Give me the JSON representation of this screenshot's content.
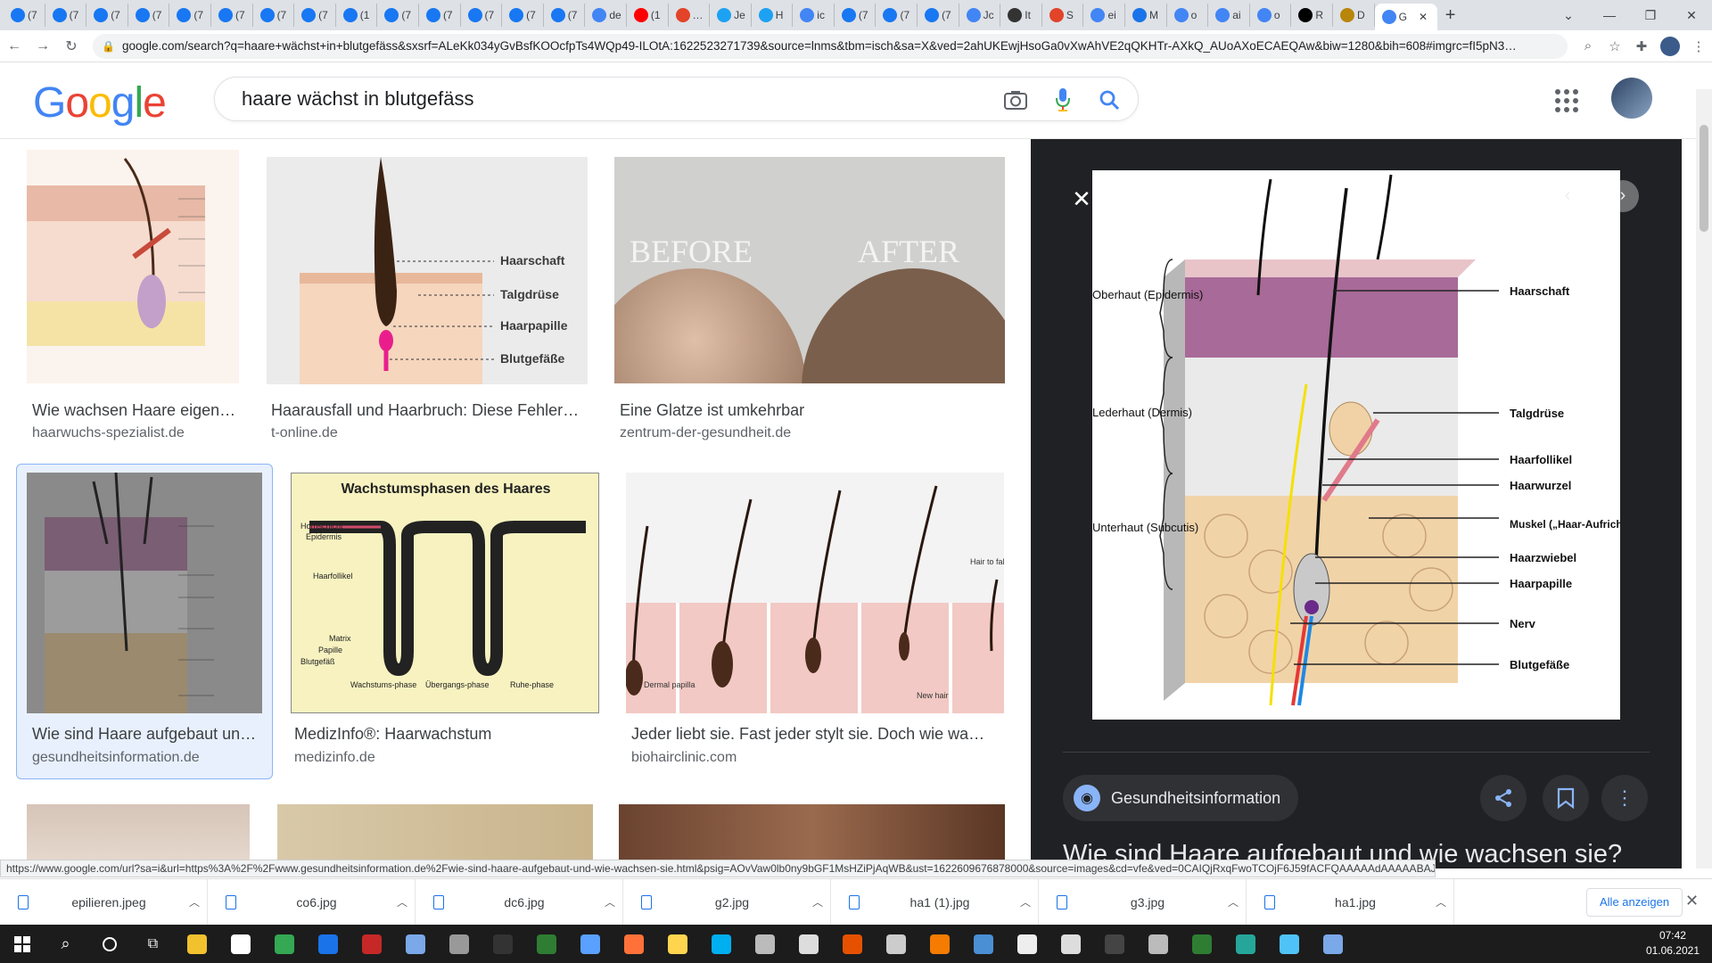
{
  "browser": {
    "tabs": [
      {
        "icon": "facebook-icon",
        "color": "#1877f2",
        "label": "(7"
      },
      {
        "icon": "facebook-icon",
        "color": "#1877f2",
        "label": "(7"
      },
      {
        "icon": "facebook-icon",
        "color": "#1877f2",
        "label": "(7"
      },
      {
        "icon": "facebook-icon",
        "color": "#1877f2",
        "label": "(7"
      },
      {
        "icon": "facebook-icon",
        "color": "#1877f2",
        "label": "(7"
      },
      {
        "icon": "facebook-icon",
        "color": "#1877f2",
        "label": "(7"
      },
      {
        "icon": "facebook-icon",
        "color": "#1877f2",
        "label": "(7"
      },
      {
        "icon": "facebook-icon",
        "color": "#1877f2",
        "label": "(7"
      },
      {
        "icon": "facebook-icon",
        "color": "#1877f2",
        "label": "(1"
      },
      {
        "icon": "facebook-icon",
        "color": "#1877f2",
        "label": "(7"
      },
      {
        "icon": "facebook-icon",
        "color": "#1877f2",
        "label": "(7"
      },
      {
        "icon": "facebook-icon",
        "color": "#1877f2",
        "label": "(7"
      },
      {
        "icon": "facebook-icon",
        "color": "#1877f2",
        "label": "(7"
      },
      {
        "icon": "facebook-icon",
        "color": "#1877f2",
        "label": "(7"
      },
      {
        "icon": "google-icon",
        "color": "#4285f4",
        "label": "de"
      },
      {
        "icon": "youtube-icon",
        "color": "#ff0000",
        "label": "(1"
      },
      {
        "icon": "gitlab-icon",
        "color": "#e24329",
        "label": "…"
      },
      {
        "icon": "twitter-icon",
        "color": "#1da1f2",
        "label": "Je"
      },
      {
        "icon": "twitter-icon",
        "color": "#1da1f2",
        "label": "H"
      },
      {
        "icon": "google-icon",
        "color": "#4285f4",
        "label": "ic"
      },
      {
        "icon": "facebook-icon",
        "color": "#1877f2",
        "label": "(7"
      },
      {
        "icon": "facebook-icon",
        "color": "#1877f2",
        "label": "(7"
      },
      {
        "icon": "facebook-icon",
        "color": "#1877f2",
        "label": "(7"
      },
      {
        "icon": "google-icon",
        "color": "#4285f4",
        "label": "Jc"
      },
      {
        "icon": "github-icon",
        "color": "#333333",
        "label": "It"
      },
      {
        "icon": "gitlab-icon",
        "color": "#e24329",
        "label": "S"
      },
      {
        "icon": "google-icon",
        "color": "#4285f4",
        "label": "ei"
      },
      {
        "icon": "m-icon",
        "color": "#1a73e8",
        "label": "M"
      },
      {
        "icon": "google-icon",
        "color": "#4285f4",
        "label": "o"
      },
      {
        "icon": "google-icon",
        "color": "#4285f4",
        "label": "ai"
      },
      {
        "icon": "google-icon",
        "color": "#4285f4",
        "label": "o"
      },
      {
        "icon": "wikipedia-icon",
        "color": "#000000",
        "label": "R"
      },
      {
        "icon": "book-icon",
        "color": "#b8860b",
        "label": "D"
      },
      {
        "icon": "google-icon",
        "color": "#4285f4",
        "label": "G",
        "active": true
      }
    ],
    "new_tab": "+",
    "url": "google.com/search?q=haare+wächst+in+blutgefäss&sxsrf=ALeKk034yGvBsfKOOcfpTs4WQp49-ILOtA:1622523271739&source=lnms&tbm=isch&sa=X&ved=2ahUKEwjHsoGa0vXwAhVE2qQKHTr-AXkQ_AUoAXoECAEQAw&biw=1280&bih=608#imgrc=fI5pN3…"
  },
  "google": {
    "logo": "Google",
    "logo_colors": [
      "#4285f4",
      "#ea4335",
      "#fbbc05",
      "#4285f4",
      "#34a853",
      "#ea4335"
    ],
    "query": "haare wächst in blutgefäss"
  },
  "results": [
    {
      "title": "Wie wachsen Haare eigen…",
      "source": "haarwuchs-spezialist.de"
    },
    {
      "title": "Haarausfall und Haarbruch: Diese Fehler…",
      "source": "t-online.de",
      "labels": [
        "Haarschaft",
        "Talgdrüse",
        "Haarpapille",
        "Blutgefäße"
      ]
    },
    {
      "title": "Eine Glatze ist umkehrbar",
      "source": "zentrum-der-gesundheit.de",
      "labels": [
        "BEFORE",
        "AFTER"
      ]
    },
    {
      "title": "Wie sind Haare aufgebaut un…",
      "source": "gesundheitsinformation.de"
    },
    {
      "title": "MedizInfo®: Haarwachstum",
      "source": "medizinfo.de",
      "heading": "Wachstumsphasen des Haares",
      "labels": [
        "Hornschicht",
        "Epidermis",
        "Haarfollikel",
        "Matrix",
        "Papille",
        "Blutgefäß",
        "Wachstums-phase",
        "Übergangs-phase",
        "Ruhe-phase"
      ]
    },
    {
      "title": "Jeder liebt sie. Fast jeder stylt sie. Doch wie wa…",
      "source": "biohairclinic.com",
      "labels": [
        "Hair to fall out",
        "Dermal papilla",
        "New hair"
      ]
    }
  ],
  "preview": {
    "source": "Gesundheitsinformation",
    "title": "Wie sind Haare aufgebaut und wie wachsen sie?",
    "left_labels": [
      "Oberhaut (Epidermis)",
      "Lederhaut (Dermis)",
      "Unterhaut (Subcutis)"
    ],
    "right_labels": [
      "Haarschaft",
      "Talgdrüse",
      "Haarfollikel",
      "Haarwurzel",
      "Muskel („Haar-Aufrichter\")",
      "Haarzwiebel",
      "Haarpapille",
      "Nerv",
      "Blutgefäße"
    ]
  },
  "status_url": "https://www.google.com/url?sa=i&url=https%3A%2F%2Fwww.gesundheitsinformation.de%2Fwie-sind-haare-aufgebaut-und-wie-wachsen-sie.html&psig=AOvVaw0lb0ny9bGF1MsHZiPjAqWB&ust=1622609676878000&source=images&cd=vfe&ved=0CAIQjRxqFwoTCOjF6J59fACFQAAAAAdAAAAABAJ",
  "downloads": {
    "files": [
      "epilieren.jpeg",
      "co6.jpg",
      "dc6.jpg",
      "g2.jpg",
      "ha1 (1).jpg",
      "g3.jpg",
      "ha1.jpg"
    ],
    "show_all": "Alle anzeigen"
  },
  "taskbar": {
    "time": "07:42",
    "date": "01.06.2021"
  }
}
